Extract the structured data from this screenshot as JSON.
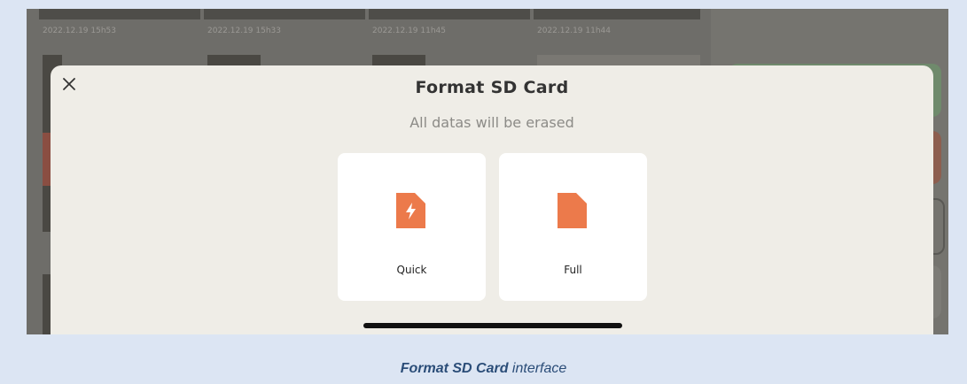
{
  "background": {
    "timestamps": [
      "2022.12.19 15h53",
      "2022.12.19 15h33",
      "2022.12.19 11h45",
      "2022.12.19 11h44"
    ]
  },
  "modal": {
    "title": "Format SD Card",
    "subtitle": "All datas will be erased",
    "close_icon": "close-icon",
    "options": [
      {
        "label": "Quick",
        "icon": "sd-card-flash-icon"
      },
      {
        "label": "Full",
        "icon": "sd-card-icon"
      }
    ]
  },
  "caption": {
    "emphasis": "Format SD Card",
    "rest": " interface"
  },
  "colors": {
    "accent": "#ec7a4b",
    "modal_bg": "#efede7",
    "page_bg": "#dce5f3",
    "caption": "#2b4d78"
  }
}
